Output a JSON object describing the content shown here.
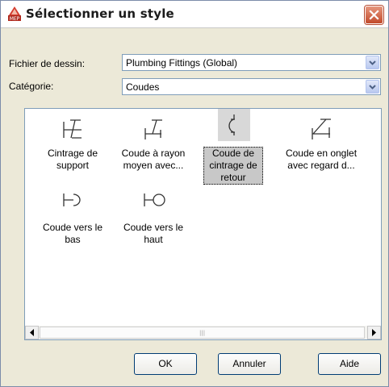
{
  "window": {
    "title": "Sélectionner un style",
    "app_icon": "autocad-mep-icon",
    "close_icon": "close-icon"
  },
  "form": {
    "drawing_file_label": "Fichier de dessin:",
    "drawing_file_value": "Plumbing Fittings (Global)",
    "category_label": "Catégorie:",
    "category_value": "Coudes"
  },
  "styles": [
    {
      "label": "Cintrage de support",
      "lines": [
        "Cintrage de",
        "support"
      ],
      "icon": "bend-support-icon",
      "selected": false
    },
    {
      "label": "Coude à rayon moyen avec...",
      "lines": [
        "Coude à rayon",
        "moyen avec..."
      ],
      "icon": "medium-radius-elbow-icon",
      "selected": false
    },
    {
      "label": "Coude de cintrage de retour",
      "lines": [
        "Coude de",
        "cintrage de",
        "retour"
      ],
      "icon": "return-bend-icon",
      "selected": true
    },
    {
      "label": "Coude en onglet avec regard d...",
      "lines": [
        "Coude en onglet",
        "avec regard d..."
      ],
      "icon": "mitered-elbow-icon",
      "selected": false
    },
    {
      "label": "Coude vers le bas",
      "lines": [
        "Coude vers le",
        "bas"
      ],
      "icon": "elbow-down-icon",
      "selected": false
    },
    {
      "label": "Coude vers le haut",
      "lines": [
        "Coude vers le",
        "haut"
      ],
      "icon": "elbow-up-icon",
      "selected": false
    }
  ],
  "buttons": {
    "ok": "OK",
    "cancel": "Annuler",
    "help": "Aide"
  },
  "colors": {
    "dialog_bg": "#ece9d8",
    "button_border": "#003c74",
    "close_red": "#c24a2b",
    "selection_gray": "#c8c8c8"
  }
}
